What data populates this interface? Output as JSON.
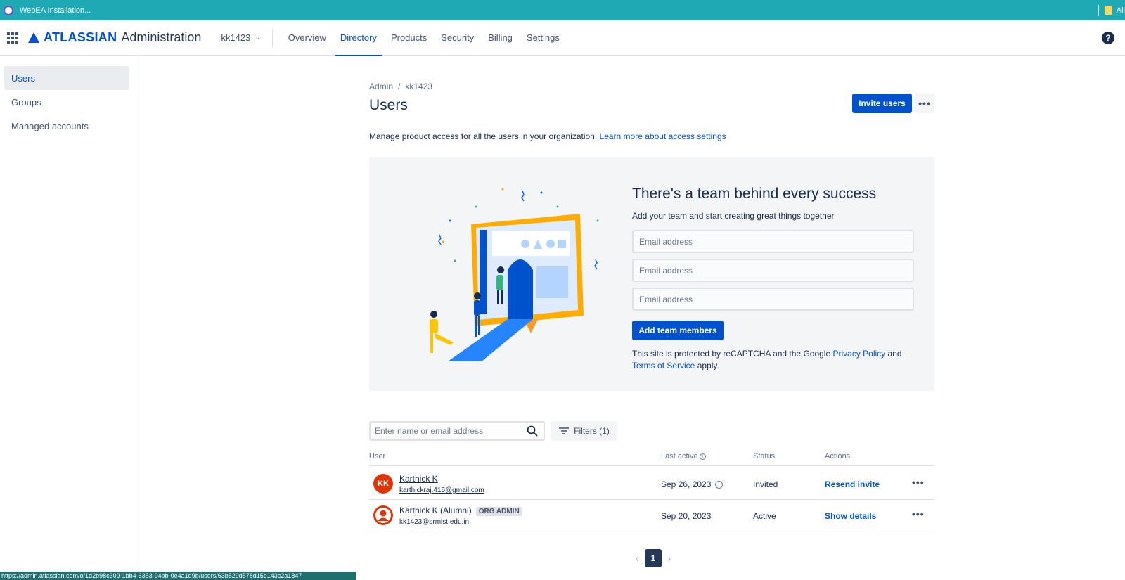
{
  "bookmarks": {
    "left_label": "WebEA Installation...",
    "right_label": "All"
  },
  "topnav": {
    "brand": "ATLASSIAN",
    "brand_sub": "Administration",
    "org": "kk1423",
    "tabs": [
      {
        "label": "Overview"
      },
      {
        "label": "Directory"
      },
      {
        "label": "Products"
      },
      {
        "label": "Security"
      },
      {
        "label": "Billing"
      },
      {
        "label": "Settings"
      }
    ],
    "help": "?"
  },
  "sidebar": {
    "items": [
      {
        "label": "Users"
      },
      {
        "label": "Groups"
      },
      {
        "label": "Managed accounts"
      }
    ]
  },
  "main": {
    "breadcrumb": [
      "Admin",
      "kk1423"
    ],
    "title": "Users",
    "invite_label": "Invite users",
    "description": "Manage product access for all the users in your organization.",
    "description_link": "Learn more about access settings"
  },
  "promo": {
    "title": "There's a team behind every success",
    "subtitle": "Add your team and start creating great things together",
    "email_placeholder": "Email address",
    "add_label": "Add team members",
    "captcha_text_1": "This site is protected by reCAPTCHA and the Google",
    "privacy_link": "Privacy Policy",
    "captcha_and": "and",
    "terms_link": "Terms of Service",
    "captcha_apply": "apply."
  },
  "toolbar": {
    "search_placeholder": "Enter name or email address",
    "filters_label": "Filters (1)"
  },
  "table": {
    "headers": {
      "user": "User",
      "last_active": "Last active",
      "status": "Status",
      "actions": "Actions"
    },
    "rows": [
      {
        "initials": "KK",
        "name": "Karthick K",
        "email": "karthickraj.415@gmail.com",
        "badge": "",
        "last_active": "Sep 26, 2023",
        "status": "Invited",
        "action": "Resend invite"
      },
      {
        "initials": "",
        "name": "Karthick K (Alumni)",
        "email": "kk1423@srmist.edu.in",
        "badge": "ORG ADMIN",
        "last_active": "Sep 20, 2023",
        "status": "Active",
        "action": "Show details"
      }
    ]
  },
  "pagination": {
    "current": "1"
  },
  "statusbar": {
    "url": "https://admin.atlassian.com/o/1d2b98c309-1bb4-6353-94bb-0e4a1d9b/users/63b529d578d15e143c2a1847"
  },
  "colors": {
    "bookmarks_bar": "#1ea9b4",
    "primary": "#0052cc",
    "avatar": "#de350b"
  }
}
